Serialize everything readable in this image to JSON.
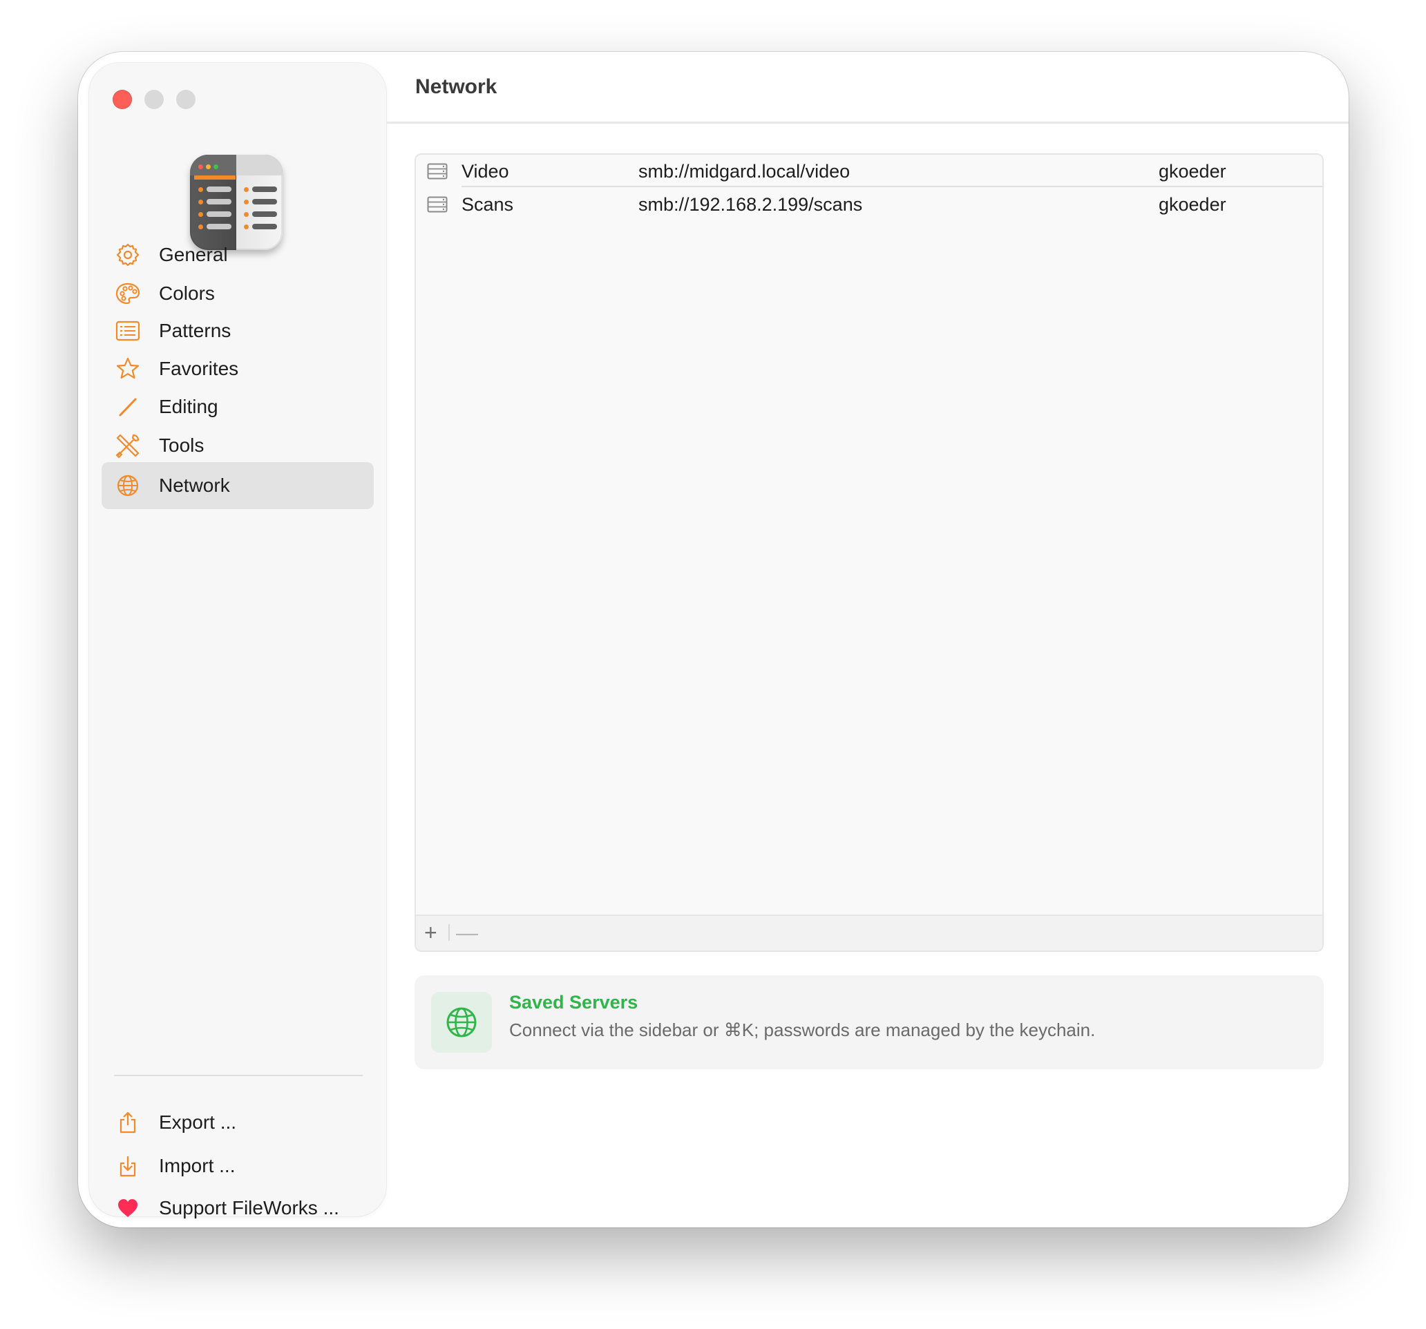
{
  "window": {
    "title": "Network"
  },
  "colors": {
    "accent": "#f28a2c",
    "selection_bg": "#e3e3e3",
    "success_green": "#2fb54a",
    "heart_red": "#ff2d55"
  },
  "sidebar": {
    "items": [
      {
        "label": "General",
        "icon": "gear-icon"
      },
      {
        "label": "Colors",
        "icon": "palette-icon"
      },
      {
        "label": "Patterns",
        "icon": "list-rect-icon"
      },
      {
        "label": "Favorites",
        "icon": "star-icon"
      },
      {
        "label": "Editing",
        "icon": "pencil-icon"
      },
      {
        "label": "Tools",
        "icon": "tools-icon"
      },
      {
        "label": "Network",
        "icon": "globe-icon",
        "selected": true
      }
    ],
    "footer": [
      {
        "label": "Export ...",
        "icon": "share-icon"
      },
      {
        "label": "Import ...",
        "icon": "import-icon"
      },
      {
        "label": "Support FileWorks ...",
        "icon": "heart-icon"
      }
    ]
  },
  "servers": {
    "rows": [
      {
        "name": "Video",
        "url": "smb://midgard.local/video",
        "user": "gkoeder"
      },
      {
        "name": "Scans",
        "url": "smb://192.168.2.199/scans",
        "user": "gkoeder"
      }
    ],
    "add_label": "+",
    "remove_label": "—"
  },
  "info": {
    "title": "Saved Servers",
    "text": "Connect via the sidebar or ⌘K; passwords are managed by the keychain."
  }
}
